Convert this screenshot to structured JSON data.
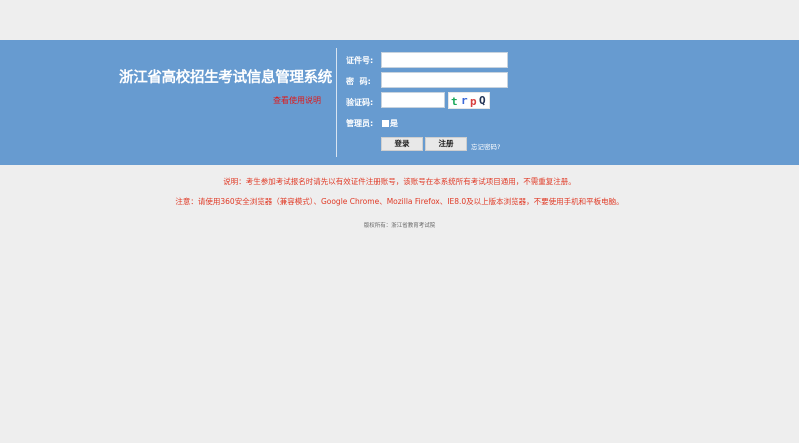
{
  "header": {
    "title": "浙江省高校招生考试信息管理系统",
    "help_link": "查看使用说明"
  },
  "login": {
    "id_label": "证件号:",
    "id_value": "",
    "password_label": "密  码:",
    "password_value": "",
    "captcha_label": "验证码:",
    "captcha_value": "",
    "captcha_text": "trpQ",
    "admin_label": "管理员:",
    "admin_checkbox_label": "是",
    "login_button": "登录",
    "register_button": "注册",
    "forgot_password": "忘记密码?"
  },
  "notes": {
    "explanation": "说明：考生参加考试报名时请先以有效证件注册账号，该账号在本系统所有考试项目通用，不需重复注册。",
    "browser_notice": "注意：请使用360安全浏览器（兼容模式）、Google Chrome、Mozilla Firefox、IE8.0及以上版本浏览器，不要使用手机和平板电脑。"
  },
  "footer": {
    "copyright": "版权所有：浙江省教育考试院"
  },
  "colors": {
    "banner": "#679bd0",
    "page_background": "#eeeeee",
    "notice_text": "#e03a26",
    "help_link": "#e01818"
  }
}
